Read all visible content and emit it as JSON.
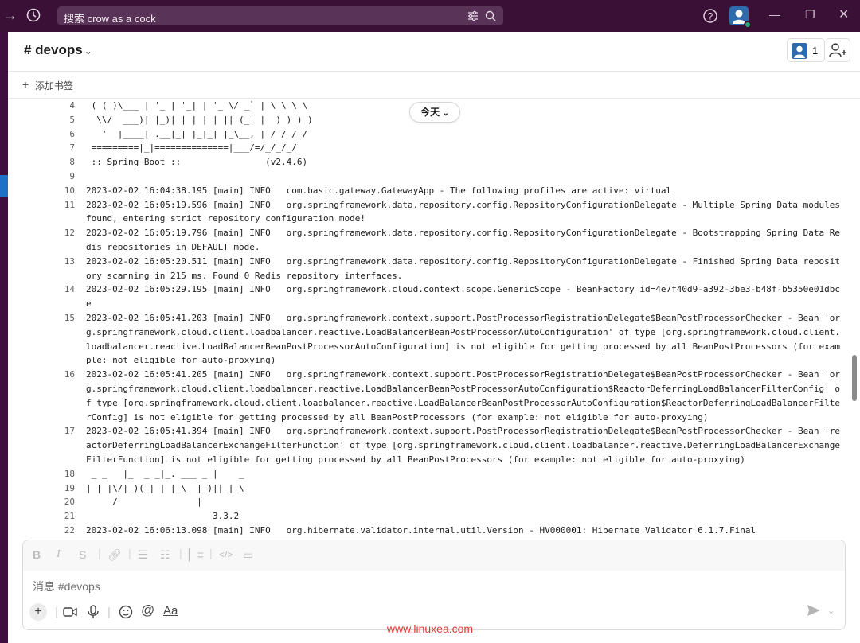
{
  "topbar": {
    "search_placeholder": "搜索 crow as a cock"
  },
  "channel": {
    "name": "# devops",
    "member_count": "1",
    "bookmark_label": "添加书签"
  },
  "log": {
    "date_pill": "今天",
    "lines": [
      {
        "n": "4",
        "t": " ( ( )\\___ | '_ | '_| | '_ \\/ _` | \\ \\ \\ \\"
      },
      {
        "n": "5",
        "t": "  \\\\/  ___)| |_)| | | | | || (_| |  ) ) ) )"
      },
      {
        "n": "6",
        "t": "   '  |____| .__|_| |_|_| |_\\__, | / / / /"
      },
      {
        "n": "7",
        "t": " =========|_|==============|___/=/_/_/_/"
      },
      {
        "n": "8",
        "t": " :: Spring Boot ::                (v2.4.6)"
      },
      {
        "n": "9",
        "t": ""
      },
      {
        "n": "10",
        "t": "2023-02-02 16:04:38.195 [main] INFO   com.basic.gateway.GatewayApp - The following profiles are active: virtual"
      },
      {
        "n": "11",
        "t": "2023-02-02 16:05:19.596 [main] INFO   org.springframework.data.repository.config.RepositoryConfigurationDelegate - Multiple Spring Data modules found, entering strict repository configuration mode!"
      },
      {
        "n": "12",
        "t": "2023-02-02 16:05:19.796 [main] INFO   org.springframework.data.repository.config.RepositoryConfigurationDelegate - Bootstrapping Spring Data Redis repositories in DEFAULT mode."
      },
      {
        "n": "13",
        "t": "2023-02-02 16:05:20.511 [main] INFO   org.springframework.data.repository.config.RepositoryConfigurationDelegate - Finished Spring Data repository scanning in 215 ms. Found 0 Redis repository interfaces."
      },
      {
        "n": "14",
        "t": "2023-02-02 16:05:29.195 [main] INFO   org.springframework.cloud.context.scope.GenericScope - BeanFactory id=4e7f40d9-a392-3be3-b48f-b5350e01dbce"
      },
      {
        "n": "15",
        "t": "2023-02-02 16:05:41.203 [main] INFO   org.springframework.context.support.PostProcessorRegistrationDelegate$BeanPostProcessorChecker - Bean 'org.springframework.cloud.client.loadbalancer.reactive.LoadBalancerBeanPostProcessorAutoConfiguration' of type [org.springframework.cloud.client.loadbalancer.reactive.LoadBalancerBeanPostProcessorAutoConfiguration] is not eligible for getting processed by all BeanPostProcessors (for example: not eligible for auto-proxying)"
      },
      {
        "n": "16",
        "t": "2023-02-02 16:05:41.205 [main] INFO   org.springframework.context.support.PostProcessorRegistrationDelegate$BeanPostProcessorChecker - Bean 'org.springframework.cloud.client.loadbalancer.reactive.LoadBalancerBeanPostProcessorAutoConfiguration$ReactorDeferringLoadBalancerFilterConfig' of type [org.springframework.cloud.client.loadbalancer.reactive.LoadBalancerBeanPostProcessorAutoConfiguration$ReactorDeferringLoadBalancerFilterConfig] is not eligible for getting processed by all BeanPostProcessors (for example: not eligible for auto-proxying)"
      },
      {
        "n": "17",
        "t": "2023-02-02 16:05:41.394 [main] INFO   org.springframework.context.support.PostProcessorRegistrationDelegate$BeanPostProcessorChecker - Bean 'reactorDeferringLoadBalancerExchangeFilterFunction' of type [org.springframework.cloud.client.loadbalancer.reactive.DeferringLoadBalancerExchangeFilterFunction] is not eligible for getting processed by all BeanPostProcessors (for example: not eligible for auto-proxying)"
      },
      {
        "n": "18",
        "t": " _ _   |_  _ _|_. ___ _ |    _"
      },
      {
        "n": "19",
        "t": "| | |\\/|_)(_| | |_\\  |_)||_|_\\"
      },
      {
        "n": "20",
        "t": "     /               |"
      },
      {
        "n": "21",
        "t": "                        3.3.2"
      },
      {
        "n": "22",
        "t": "2023-02-02 16:06:13.098 [main] INFO   org.hibernate.validator.internal.util.Version - HV000001: Hibernate Validator 6.1.7.Final"
      }
    ]
  },
  "composer": {
    "placeholder": "消息 #devops"
  },
  "watermark": "www.linuxea.com"
}
